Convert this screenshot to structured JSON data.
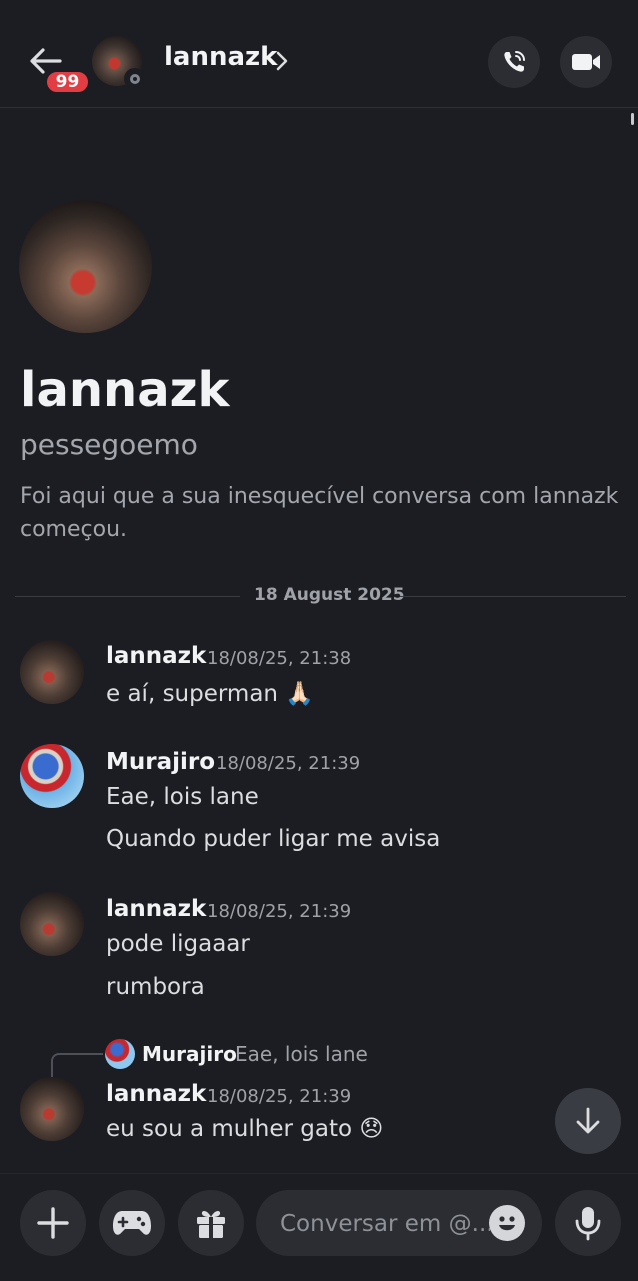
{
  "header": {
    "badge_count": "99",
    "name": "lannazk",
    "chevron": "›",
    "status": "offline"
  },
  "profile": {
    "display_name": "lannazk",
    "username": "pessegoemo",
    "intro_line1": "Foi aqui que a sua inesquecível conversa com lannazk",
    "intro_line2": "começou."
  },
  "date_divider": "18 August 2025",
  "messages": [
    {
      "author": "lannazk",
      "time": "18/08/25, 21:38",
      "lines": [
        "e aí, superman 🙏🏻"
      ]
    },
    {
      "author": "Murajiro",
      "time": "18/08/25, 21:39",
      "lines": [
        "Eae, lois lane",
        "Quando puder ligar me avisa"
      ]
    },
    {
      "author": "lannazk",
      "time": "18/08/25, 21:39",
      "lines": [
        "pode ligaaar",
        "rumbora"
      ]
    },
    {
      "author": "lannazk",
      "time": "18/08/25, 21:39",
      "lines": [
        "eu sou a mulher gato 😞"
      ],
      "reply": {
        "author": "Murajiro",
        "text": "Eae, lois lane"
      }
    }
  ],
  "composer": {
    "placeholder": "Conversar em @..."
  },
  "icons": {
    "back": "arrow-left-icon",
    "call": "phone-call-icon",
    "video": "video-camera-icon",
    "add": "plus-icon",
    "game": "gamepad-icon",
    "gift": "gift-icon",
    "emoji": "emoji-icon",
    "mic": "microphone-icon",
    "scroll_down": "arrow-down-icon"
  },
  "colors": {
    "background": "#1c1d22",
    "badge": "#e23d42",
    "button_bg": "#2b2d33"
  }
}
